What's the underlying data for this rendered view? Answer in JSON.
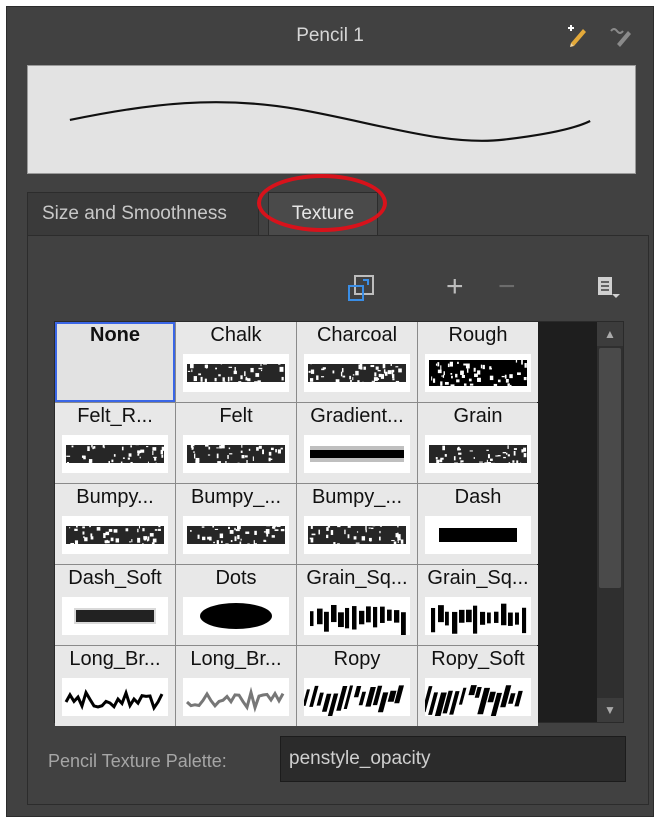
{
  "header": {
    "title": "Pencil 1",
    "icons": [
      "new-pencil-icon",
      "rename-pencil-icon"
    ]
  },
  "tabs": [
    {
      "label": "Size and Smoothness",
      "active": false
    },
    {
      "label": "Texture",
      "active": true
    }
  ],
  "toolbar": {
    "icons": [
      "import-texture-icon",
      "add-icon",
      "remove-icon",
      "menu-icon"
    ]
  },
  "textures": [
    {
      "label": "None",
      "selected": true
    },
    {
      "label": "Chalk"
    },
    {
      "label": "Charcoal"
    },
    {
      "label": "Rough"
    },
    {
      "label": "Felt_R..."
    },
    {
      "label": "Felt"
    },
    {
      "label": "Gradient..."
    },
    {
      "label": "Grain"
    },
    {
      "label": "Bumpy..."
    },
    {
      "label": "Bumpy_..."
    },
    {
      "label": "Bumpy_..."
    },
    {
      "label": "Dash"
    },
    {
      "label": "Dash_Soft"
    },
    {
      "label": "Dots"
    },
    {
      "label": "Grain_Sq..."
    },
    {
      "label": "Grain_Sq..."
    },
    {
      "label": "Long_Br..."
    },
    {
      "label": "Long_Br..."
    },
    {
      "label": "Ropy"
    },
    {
      "label": "Ropy_Soft"
    }
  ],
  "palette": {
    "label": "Pencil Texture Palette:",
    "value": "penstyle_opacity"
  },
  "colors": {
    "panel": "#414141",
    "selection": "#3a66e6",
    "highlight_circle": "#d8121b"
  }
}
